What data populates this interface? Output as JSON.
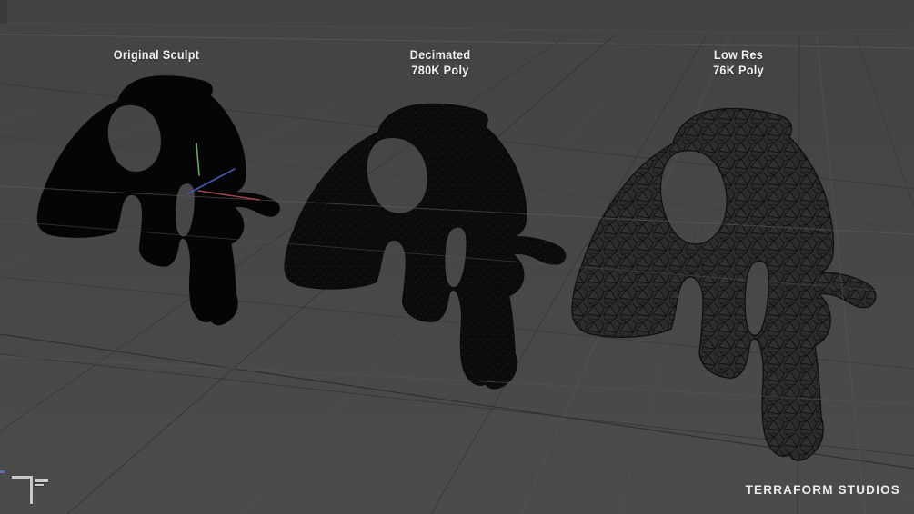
{
  "viewport": {
    "background": "#484848",
    "grid_light_color": "#5c5c5c",
    "grid_dark_color": "#343434"
  },
  "labels": [
    {
      "title": "Original Sculpt",
      "subtitle": ""
    },
    {
      "title": "Decimated",
      "subtitle": "780K Poly"
    },
    {
      "title": "Low Res",
      "subtitle": "76K Poly"
    }
  ],
  "watermark": {
    "text": "TERRAFORM STUDIOS"
  },
  "gizmo": {
    "axis_up_color": "#63a863",
    "axis_depth_color": "#4458b8",
    "axis_side_color": "#b04a4a"
  }
}
